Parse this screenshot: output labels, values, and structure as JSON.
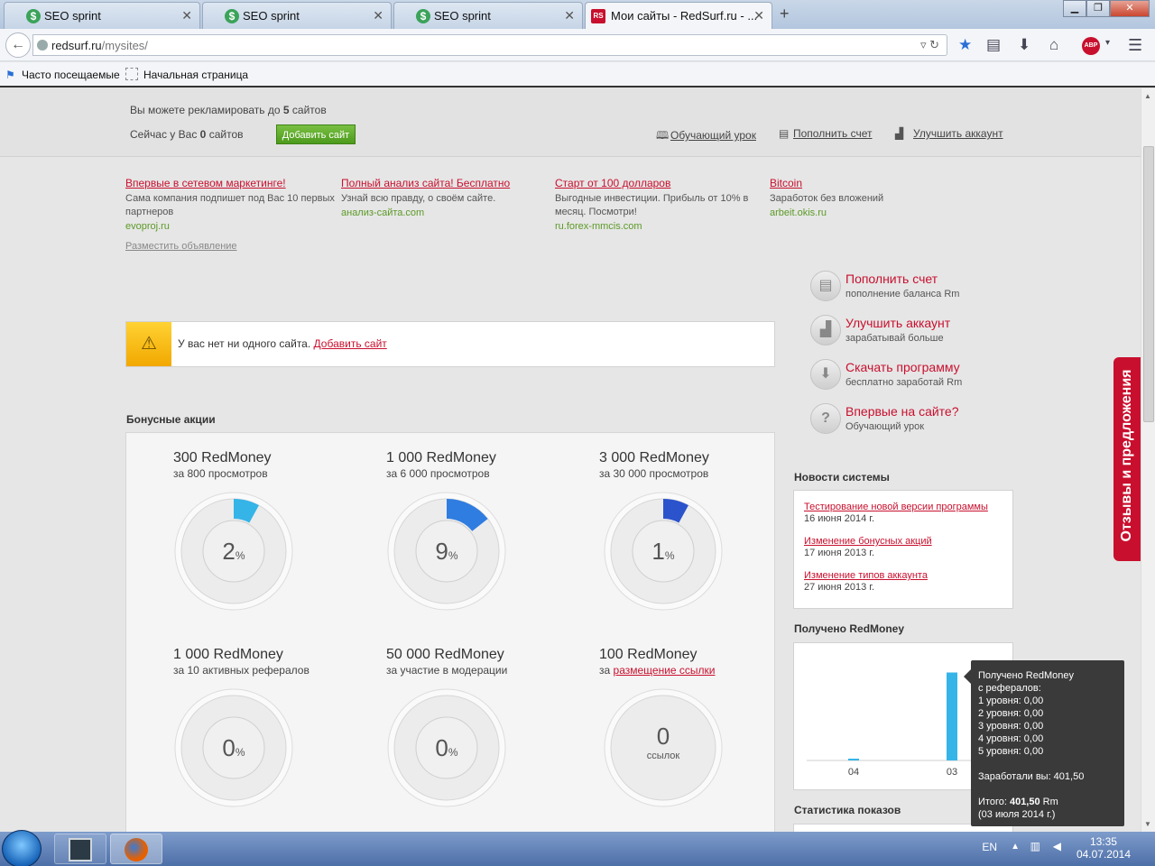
{
  "browser": {
    "tabs": [
      {
        "label": "SEO sprint"
      },
      {
        "label": "SEO sprint"
      },
      {
        "label": "SEO sprint"
      },
      {
        "label": "Мои сайты - RedSurf.ru - ..."
      }
    ],
    "new_tab": "+",
    "url_host": "redsurf.ru",
    "url_path": "/mysites/",
    "abp_label": "ABP",
    "bookmarks": [
      "Часто посещаемые",
      "Начальная страница"
    ]
  },
  "header": {
    "limit_prefix": "Вы можете рекламировать до",
    "limit_value": "5",
    "limit_suffix": "сайтов",
    "current_prefix": "Сейчас у Вас",
    "current_value": "0",
    "current_suffix": "сайтов",
    "add_site_button": "Добавить сайт",
    "links": [
      "Обучающий урок",
      "Пополнить счет",
      "Улучшить аккаунт"
    ]
  },
  "ads": [
    {
      "title": "Впервые в сетевом маркетинге!",
      "desc": "Сама компания подпишет под Вас 10 первых партнеров",
      "url": "evoproj.ru"
    },
    {
      "title": "Полный анализ сайта! Бесплатно",
      "desc": "Узнай всю правду, о своём сайте.",
      "url": "анализ-сайта.com"
    },
    {
      "title": "Старт от 100 долларов",
      "desc": "Выгодные инвестиции. Прибыль от 10% в месяц. Посмотри!",
      "url": "ru.forex-mmcis.com"
    },
    {
      "title": "Bitcoin",
      "desc": "Заработок без вложений",
      "url": "arbeit.okis.ru"
    }
  ],
  "place_ad_link": "Разместить объявление",
  "alert": {
    "text": "У вас нет ни одного сайта.",
    "link": "Добавить сайт"
  },
  "bonus": {
    "title": "Бонусные акции",
    "items": [
      {
        "amount": "300 RedMoney",
        "condition": "за 800 просмотров",
        "percent": 2,
        "display": "2",
        "unit": "%",
        "color": "#35b4e8"
      },
      {
        "amount": "1 000 RedMoney",
        "condition": "за 6 000 просмотров",
        "percent": 9,
        "display": "9",
        "unit": "%",
        "color": "#2f7de0"
      },
      {
        "amount": "3 000 RedMoney",
        "condition": "за 30 000 просмотров",
        "percent": 1,
        "display": "1",
        "unit": "%",
        "color": "#2b53cc"
      },
      {
        "amount": "1 000 RedMoney",
        "condition": "за 10 активных рефералов",
        "percent": 0,
        "display": "0",
        "unit": "%",
        "color": "#35b4e8"
      },
      {
        "amount": "50 000 RedMoney",
        "condition": "за участие в модерации",
        "percent": 0,
        "display": "0",
        "unit": "%",
        "color": "#35b4e8"
      },
      {
        "amount": "100 RedMoney",
        "condition_prefix": "за",
        "condition_link": "размещение ссылки",
        "display": "0",
        "unit": "ссылок"
      }
    ]
  },
  "actions": [
    {
      "title": "Пополнить счет",
      "sub": "пополнение баланса Rm",
      "icon": "wallet-icon"
    },
    {
      "title": "Улучшить аккаунт",
      "sub": "зарабатывай больше",
      "icon": "chart-up-icon"
    },
    {
      "title": "Скачать программу",
      "sub": "бесплатно заработай Rm",
      "icon": "download-icon"
    },
    {
      "title": "Впервые на сайте?",
      "sub": "Обучающий урок",
      "icon": "question-icon"
    }
  ],
  "news": {
    "title": "Новости системы",
    "items": [
      {
        "title": "Тестирование новой версии программы",
        "date": "16 июня 2014 г."
      },
      {
        "title": "Изменение бонусных акций",
        "date": "17 июня 2013 г."
      },
      {
        "title": "Изменение типов аккаунта",
        "date": "27 июня 2013 г."
      }
    ]
  },
  "redmoney": {
    "title": "Получено RedMoney",
    "chart_data": {
      "type": "bar",
      "categories": [
        "04",
        "03"
      ],
      "values": [
        4,
        401.5
      ],
      "ylim": [
        0,
        420
      ],
      "grid": false,
      "color": "#35b4e8"
    }
  },
  "tooltip": {
    "l1": "Получено RedMoney",
    "l2": "с рефералов:",
    "levels": [
      "1 уровня: 0,00",
      "2 уровня: 0,00",
      "3 уровня: 0,00",
      "4 уровня: 0,00",
      "5 уровня: 0,00"
    ],
    "earned": "Заработали вы: 401,50",
    "total_prefix": "Итого:",
    "total_value": "401,50",
    "total_unit": "Rm",
    "date": "(03 июля 2014 г.)"
  },
  "stats_title": "Статистика показов",
  "feedback_label": "Отзывы и предложения",
  "taskbar": {
    "lang": "EN",
    "time": "13:35",
    "date": "04.07.2014"
  }
}
